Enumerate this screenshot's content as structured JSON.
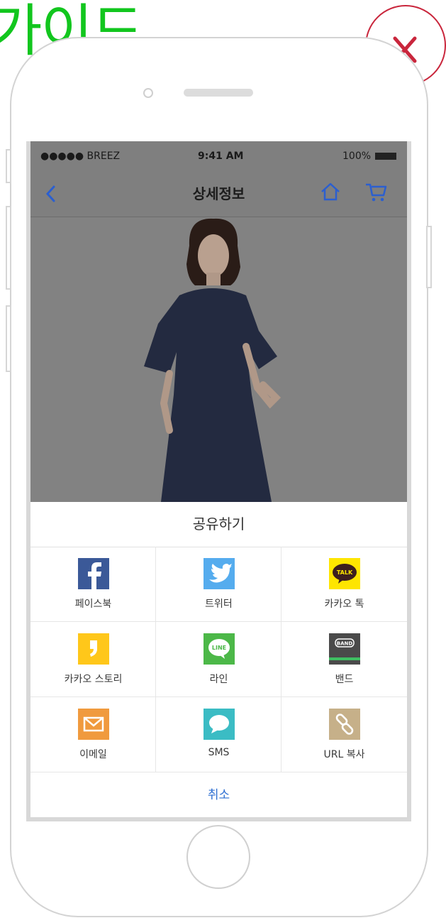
{
  "guide_heading": "가이드",
  "close_label": "close",
  "status_bar": {
    "carrier": "●●●●● BREEZ",
    "time": "9:41 AM",
    "battery": "100%"
  },
  "nav": {
    "title": "상세정보"
  },
  "share_sheet": {
    "title": "공유하기",
    "items": [
      {
        "label": "페이스북",
        "icon": "facebook-icon",
        "color": "#3b5998"
      },
      {
        "label": "트위터",
        "icon": "twitter-icon",
        "color": "#55acee"
      },
      {
        "label": "카카오 톡",
        "icon": "kakaotalk-icon",
        "color": "#fee500"
      },
      {
        "label": "카카오 스토리",
        "icon": "kakaostory-icon",
        "color": "#ffc71a"
      },
      {
        "label": "라인",
        "icon": "line-icon",
        "color": "#4cb848"
      },
      {
        "label": "밴드",
        "icon": "band-icon",
        "color": "#4a4a4a"
      },
      {
        "label": "이메일",
        "icon": "email-icon",
        "color": "#f09a3e"
      },
      {
        "label": "SMS",
        "icon": "sms-icon",
        "color": "#3bbcc4"
      },
      {
        "label": "URL 복사",
        "icon": "link-icon",
        "color": "#c6b089"
      }
    ],
    "badges": {
      "talk": "TALK",
      "line": "LINE",
      "band": "BAND"
    },
    "cancel": "취소"
  },
  "colors": {
    "heading": "#12c61e",
    "close": "#c9263c",
    "nav_icons": "#2b5fd0",
    "cancel": "#2e6fd2"
  }
}
